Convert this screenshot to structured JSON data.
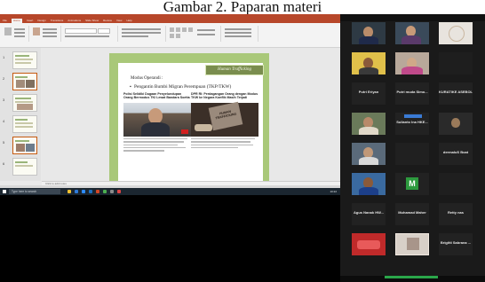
{
  "caption": "Gambar 2. Paparan materi",
  "powerpoint": {
    "tabs": [
      "File",
      "Home",
      "Insert",
      "Design",
      "Transitions",
      "Animations",
      "Slide Show",
      "Review",
      "View",
      "Help"
    ],
    "active_tab": "Home",
    "thumbnail_numbers": [
      "1",
      "2",
      "3",
      "4",
      "5",
      "6"
    ],
    "notes_placeholder": "Click to add notes",
    "slide": {
      "tag": "Human Trafficking",
      "title_line1": "Modus Operandi :",
      "title_line2": "Pengantin Bumbi Migran Perempuan (TKP/TKW)",
      "article_left_headline": "Polisi Selidiki Dugaan Penyelundupan Orang Bermodus TKI Lewat Bandara Soetta",
      "article_right_headline": "DPR RI: Perdagangan Orang dengan Modus TKW ke Negara Konflik Masih Terjadi",
      "article_right_image_text": "HUMAN TRAFFICKING"
    },
    "accent_color": "#b7472a",
    "slide_bg_color": "#a9c879"
  },
  "taskbar": {
    "search_placeholder": "Type here to search",
    "time": "10:22"
  },
  "zoom": {
    "participants": [
      {
        "name": "",
        "kind": "video"
      },
      {
        "name": "",
        "kind": "video"
      },
      {
        "name": "",
        "kind": "video"
      },
      {
        "name": "",
        "kind": "video"
      },
      {
        "name": "",
        "kind": "video"
      },
      {
        "name": "",
        "kind": "video"
      },
      {
        "name": "Putri Eriyan",
        "kind": "name-only"
      },
      {
        "name": "Putri muda Simo...",
        "kind": "name-only"
      },
      {
        "name": "KURATIKE ASEBOL...",
        "kind": "name-only"
      },
      {
        "name": "",
        "kind": "video"
      },
      {
        "name": "Sulianto Ina  HKE...",
        "kind": "name-only"
      },
      {
        "name": "",
        "kind": "video"
      },
      {
        "name": "",
        "kind": "video"
      },
      {
        "name": "",
        "kind": "video"
      },
      {
        "name": "dermaluS Boat",
        "kind": "name-only"
      },
      {
        "name": "",
        "kind": "video"
      },
      {
        "name": "M",
        "kind": "avatar"
      },
      {
        "name": "",
        "kind": "video"
      },
      {
        "name": "Agus Nanak HW...",
        "kind": "name-only"
      },
      {
        "name": "Muhamad Maher",
        "kind": "name-only"
      },
      {
        "name": "Retty nas",
        "kind": "name-only"
      },
      {
        "name": "",
        "kind": "video"
      },
      {
        "name": "",
        "kind": "video"
      },
      {
        "name": "Brigitti Sabrana ...",
        "kind": "name-only"
      }
    ]
  }
}
